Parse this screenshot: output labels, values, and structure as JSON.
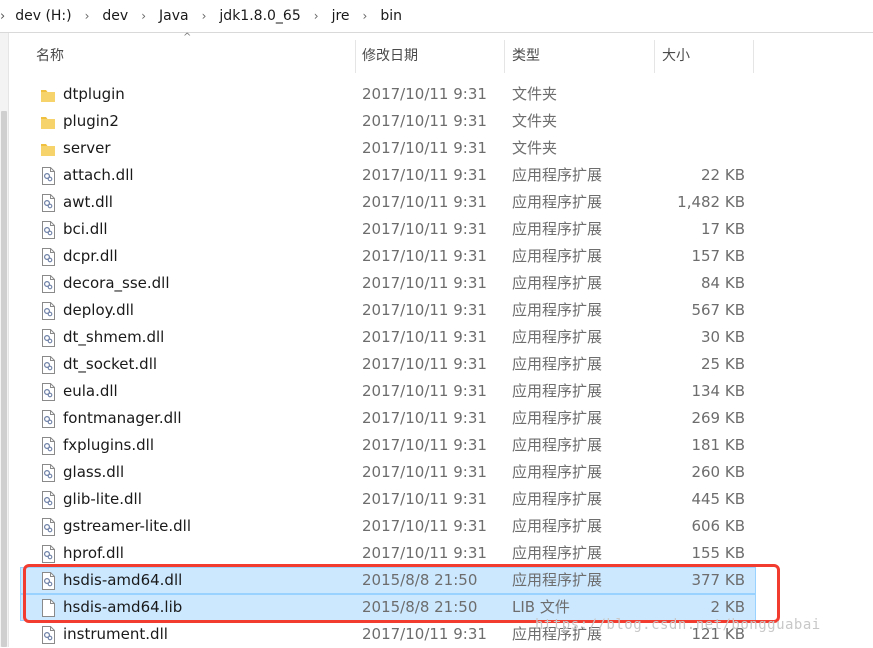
{
  "breadcrumb": [
    "dev (H:)",
    "dev",
    "Java",
    "jdk1.8.0_65",
    "jre",
    "bin"
  ],
  "columns": {
    "name": "名称",
    "date": "修改日期",
    "type": "类型",
    "size": "大小"
  },
  "rows": [
    {
      "name": "dtplugin",
      "date": "2017/10/11 9:31",
      "type": "文件夹",
      "size": "",
      "icon": "folder-icon",
      "selected": false
    },
    {
      "name": "plugin2",
      "date": "2017/10/11 9:31",
      "type": "文件夹",
      "size": "",
      "icon": "folder-icon",
      "selected": false
    },
    {
      "name": "server",
      "date": "2017/10/11 9:31",
      "type": "文件夹",
      "size": "",
      "icon": "folder-icon",
      "selected": false
    },
    {
      "name": "attach.dll",
      "date": "2017/10/11 9:31",
      "type": "应用程序扩展",
      "size": "22 KB",
      "icon": "dll-file-icon",
      "selected": false
    },
    {
      "name": "awt.dll",
      "date": "2017/10/11 9:31",
      "type": "应用程序扩展",
      "size": "1,482 KB",
      "icon": "dll-file-icon",
      "selected": false
    },
    {
      "name": "bci.dll",
      "date": "2017/10/11 9:31",
      "type": "应用程序扩展",
      "size": "17 KB",
      "icon": "dll-file-icon",
      "selected": false
    },
    {
      "name": "dcpr.dll",
      "date": "2017/10/11 9:31",
      "type": "应用程序扩展",
      "size": "157 KB",
      "icon": "dll-file-icon",
      "selected": false
    },
    {
      "name": "decora_sse.dll",
      "date": "2017/10/11 9:31",
      "type": "应用程序扩展",
      "size": "84 KB",
      "icon": "dll-file-icon",
      "selected": false
    },
    {
      "name": "deploy.dll",
      "date": "2017/10/11 9:31",
      "type": "应用程序扩展",
      "size": "567 KB",
      "icon": "dll-file-icon",
      "selected": false
    },
    {
      "name": "dt_shmem.dll",
      "date": "2017/10/11 9:31",
      "type": "应用程序扩展",
      "size": "30 KB",
      "icon": "dll-file-icon",
      "selected": false
    },
    {
      "name": "dt_socket.dll",
      "date": "2017/10/11 9:31",
      "type": "应用程序扩展",
      "size": "25 KB",
      "icon": "dll-file-icon",
      "selected": false
    },
    {
      "name": "eula.dll",
      "date": "2017/10/11 9:31",
      "type": "应用程序扩展",
      "size": "134 KB",
      "icon": "dll-file-icon",
      "selected": false
    },
    {
      "name": "fontmanager.dll",
      "date": "2017/10/11 9:31",
      "type": "应用程序扩展",
      "size": "269 KB",
      "icon": "dll-file-icon",
      "selected": false
    },
    {
      "name": "fxplugins.dll",
      "date": "2017/10/11 9:31",
      "type": "应用程序扩展",
      "size": "181 KB",
      "icon": "dll-file-icon",
      "selected": false
    },
    {
      "name": "glass.dll",
      "date": "2017/10/11 9:31",
      "type": "应用程序扩展",
      "size": "260 KB",
      "icon": "dll-file-icon",
      "selected": false
    },
    {
      "name": "glib-lite.dll",
      "date": "2017/10/11 9:31",
      "type": "应用程序扩展",
      "size": "445 KB",
      "icon": "dll-file-icon",
      "selected": false
    },
    {
      "name": "gstreamer-lite.dll",
      "date": "2017/10/11 9:31",
      "type": "应用程序扩展",
      "size": "606 KB",
      "icon": "dll-file-icon",
      "selected": false
    },
    {
      "name": "hprof.dll",
      "date": "2017/10/11 9:31",
      "type": "应用程序扩展",
      "size": "155 KB",
      "icon": "dll-file-icon",
      "selected": false
    },
    {
      "name": "hsdis-amd64.dll",
      "date": "2015/8/8 21:50",
      "type": "应用程序扩展",
      "size": "377 KB",
      "icon": "dll-file-icon",
      "selected": true
    },
    {
      "name": "hsdis-amd64.lib",
      "date": "2015/8/8 21:50",
      "type": "LIB 文件",
      "size": "2 KB",
      "icon": "blank-file-icon",
      "selected": true
    },
    {
      "name": "instrument.dll",
      "date": "2017/10/11 9:31",
      "type": "应用程序扩展",
      "size": "121 KB",
      "icon": "dll-file-icon",
      "selected": false
    }
  ],
  "watermark": "https://blog.csdn.net/bongguabai",
  "colors": {
    "selection": "#cce8ff",
    "selection_border": "#99d1ff",
    "highlight_box": "#f23c30",
    "folder": "#f0c040"
  }
}
